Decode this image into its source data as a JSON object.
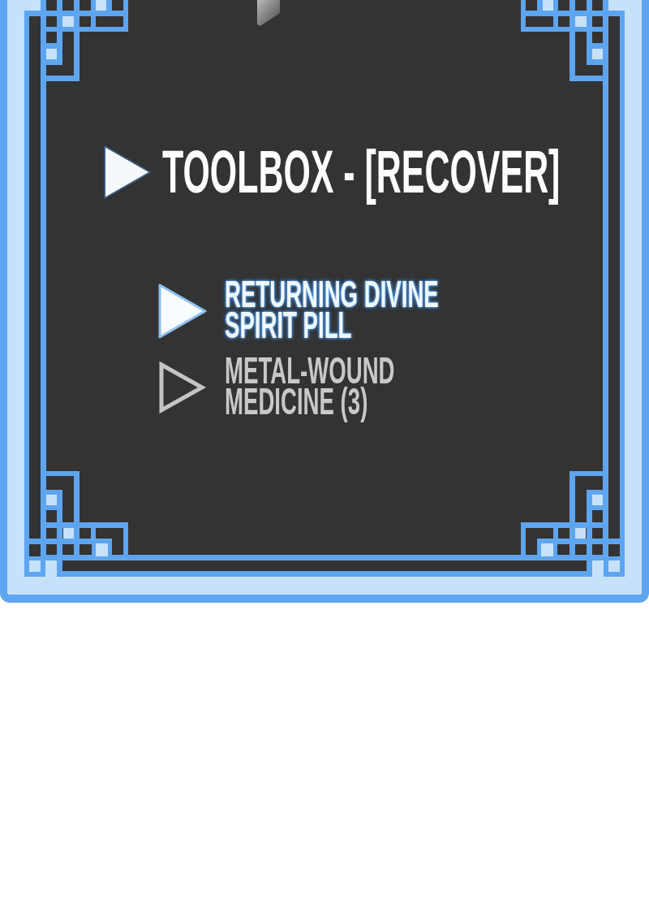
{
  "panel": {
    "title": "TOOLBOX - [RECOVER]",
    "items": [
      {
        "label": "RETURNING DIVINE SPIRIT PILL",
        "selected": true
      },
      {
        "label": "METAL-WOUND MEDICINE (3)",
        "selected": false
      }
    ]
  }
}
